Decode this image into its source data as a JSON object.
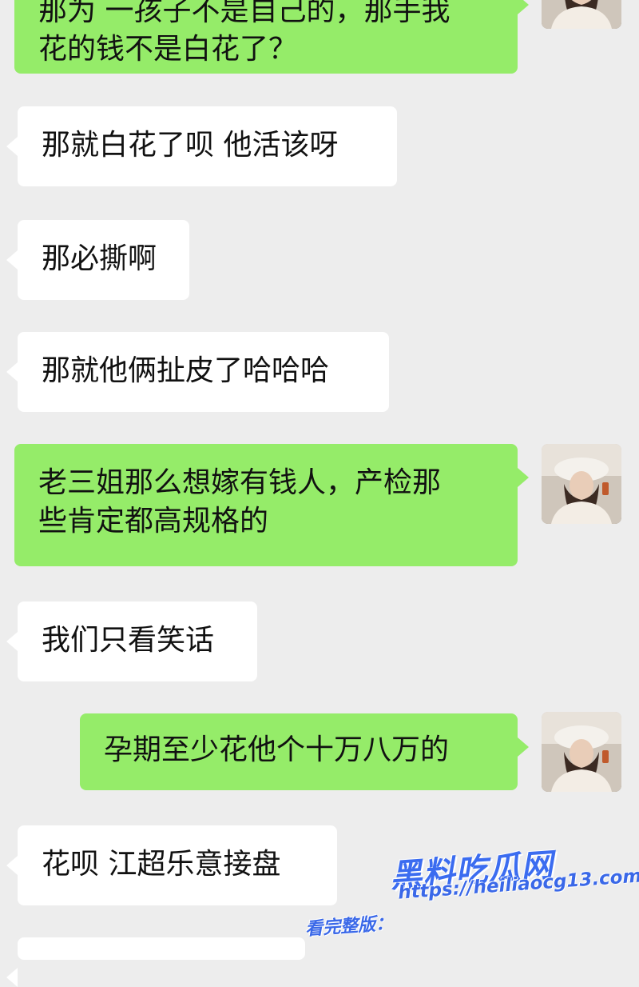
{
  "messages": [
    {
      "side": "out",
      "lines": [
        "那为 一孩子不是自己的，那手我",
        "花的钱不是白花了？"
      ]
    },
    {
      "side": "in",
      "lines": [
        "那就白花了呗 他活该呀"
      ]
    },
    {
      "side": "in",
      "lines": [
        "那必撕啊"
      ]
    },
    {
      "side": "in",
      "lines": [
        "那就他俩扯皮了哈哈哈"
      ]
    },
    {
      "side": "out",
      "lines": [
        "老三姐那么想嫁有钱人，产检那",
        "些肯定都高规格的"
      ]
    },
    {
      "side": "in",
      "lines": [
        "我们只看笑话"
      ]
    },
    {
      "side": "out",
      "lines": [
        "孕期至少花他个十万八万的"
      ]
    },
    {
      "side": "in",
      "lines": [
        "花呗  江超乐意接盘"
      ]
    }
  ],
  "avatar_icon": "user-avatar-photo",
  "colors": {
    "background": "#ededed",
    "outgoing_bubble": "#95ec69",
    "incoming_bubble": "#ffffff",
    "watermark": "#3b6cf0"
  },
  "watermark": {
    "logo_text": "黑料吃瓜网",
    "url_text": "https://heiliaocg13.com",
    "prefix_text": "看完整版："
  }
}
